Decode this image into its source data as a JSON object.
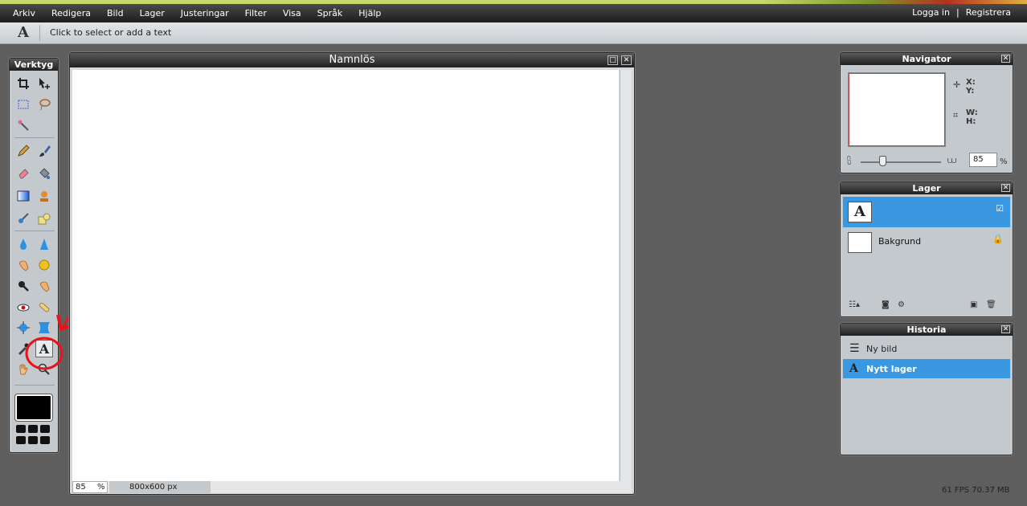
{
  "menu": {
    "items": [
      "Arkiv",
      "Redigera",
      "Bild",
      "Lager",
      "Justeringar",
      "Filter",
      "Visa",
      "Språk",
      "Hjälp"
    ],
    "login": "Logga in",
    "separator": "|",
    "register": "Registrera"
  },
  "options_bar": {
    "tool_glyph": "A",
    "hint": "Click to select or add a text"
  },
  "toolbox": {
    "title": "Verktyg",
    "selected_tool": "text-icon",
    "foreground_color": "#000000"
  },
  "document": {
    "title": "Namnlös",
    "zoom": "85",
    "zoom_unit": "%",
    "size": "800x600 px"
  },
  "navigator": {
    "title": "Navigator",
    "x_label": "X:",
    "y_label": "Y:",
    "w_label": "W:",
    "h_label": "H:",
    "zoom": "85",
    "zoom_unit": "%"
  },
  "layers": {
    "title": "Lager",
    "items": [
      {
        "name": "",
        "thumb": "A",
        "flag": "☑"
      },
      {
        "name": "Bakgrund",
        "thumb": "",
        "flag": "🔒"
      }
    ]
  },
  "history": {
    "title": "Historia",
    "items": [
      {
        "label": "Ny bild",
        "icon": "new-image-icon"
      },
      {
        "label": "Nytt lager",
        "icon": "text-layer-icon"
      }
    ]
  },
  "status": {
    "fps": "61 FPS 70.37 MB"
  },
  "colors": {
    "accent": "#3a98e0",
    "annotation": "#e8141b"
  }
}
